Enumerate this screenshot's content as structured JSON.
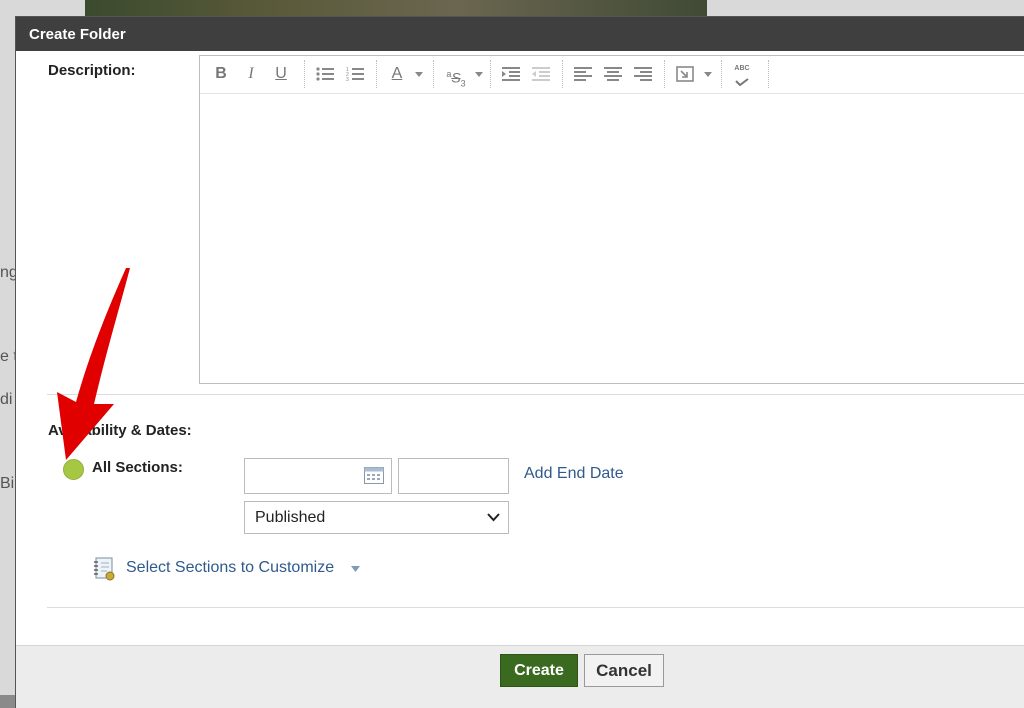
{
  "dialog": {
    "title": "Create Folder"
  },
  "description": {
    "label": "Description:",
    "toolbar": {
      "bold": "B",
      "italic": "I",
      "underline": "U",
      "font_color": "A",
      "superscript": "a",
      "strike": "S",
      "subscript": "3",
      "spellcheck": "ABC"
    }
  },
  "availability": {
    "label": "Availability & Dates:",
    "sections_label": "All Sections:",
    "start_date_value": "",
    "start_time_value": "",
    "add_end_date": "Add End Date",
    "status_selected": "Published",
    "customize_link": "Select Sections to Customize",
    "status_dot_color": "#a6c744"
  },
  "footer": {
    "create_label": "Create",
    "cancel_label": "Cancel"
  },
  "annotation": {
    "arrow_color": "#e00000"
  },
  "background": {
    "fragments": [
      "ng",
      "e t",
      "di",
      "Bi"
    ]
  }
}
